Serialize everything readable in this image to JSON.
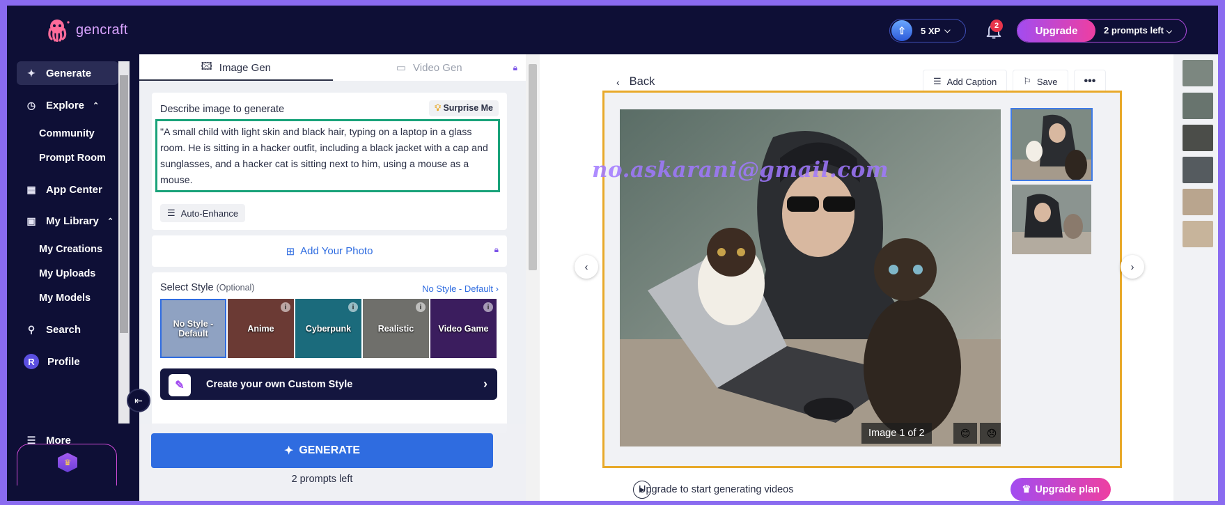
{
  "brand": {
    "name": "gencraft"
  },
  "topbar": {
    "xp_label": "5 XP",
    "notifications_count": "2",
    "upgrade_label": "Upgrade",
    "prompts_left_label": "2 prompts left"
  },
  "sidebar": {
    "generate": "Generate",
    "explore": "Explore",
    "community": "Community",
    "prompt_room": "Prompt Room",
    "app_center": "App Center",
    "my_library": "My Library",
    "my_creations": "My Creations",
    "my_uploads": "My Uploads",
    "my_models": "My Models",
    "search": "Search",
    "profile": "Profile",
    "profile_initial": "R",
    "more": "More"
  },
  "panel": {
    "tabs": [
      {
        "label": "Image Gen",
        "icon": "image-icon"
      },
      {
        "label": "Video Gen",
        "icon": "video-icon"
      }
    ],
    "describe_label": "Describe image to generate",
    "surprise_label": "Surprise Me",
    "prompt_text": "\"A small child with light skin and black hair, typing on a laptop in a glass room. He is sitting in a hacker outfit, including a black jacket with a cap and sunglasses, and a hacker cat is sitting next to him, using a mouse as a mouse.",
    "auto_enhance": "Auto-Enhance",
    "add_photo": "Add Your Photo",
    "select_style": "Select Style",
    "optional": "(Optional)",
    "style_default": "No Style - Default",
    "styles": [
      {
        "label": "No Style - Default",
        "color": "#8fa2c2"
      },
      {
        "label": "Anime",
        "color": "#6b3a34"
      },
      {
        "label": "Cyberpunk",
        "color": "#1b6b7c"
      },
      {
        "label": "Realistic",
        "color": "#6f6f6b"
      },
      {
        "label": "Video Game",
        "color": "#3b1d5e"
      }
    ],
    "custom_style": "Create your own Custom Style",
    "generate": "GENERATE",
    "prompts_left": "2 prompts left"
  },
  "viewer": {
    "back": "Back",
    "add_caption": "Add Caption",
    "save": "Save",
    "counter": "Image 1 of 2",
    "watermark": "no.askarani@gmail.com",
    "upgrade_videos": "Upgrade to start generating videos",
    "upgrade_plan": "Upgrade plan"
  },
  "colors": {
    "nav_bg": "#0e0f36",
    "accent_blue": "#2f6ce0",
    "selection_outline": "#e8a92a",
    "prompt_outline": "#1aa37a"
  }
}
